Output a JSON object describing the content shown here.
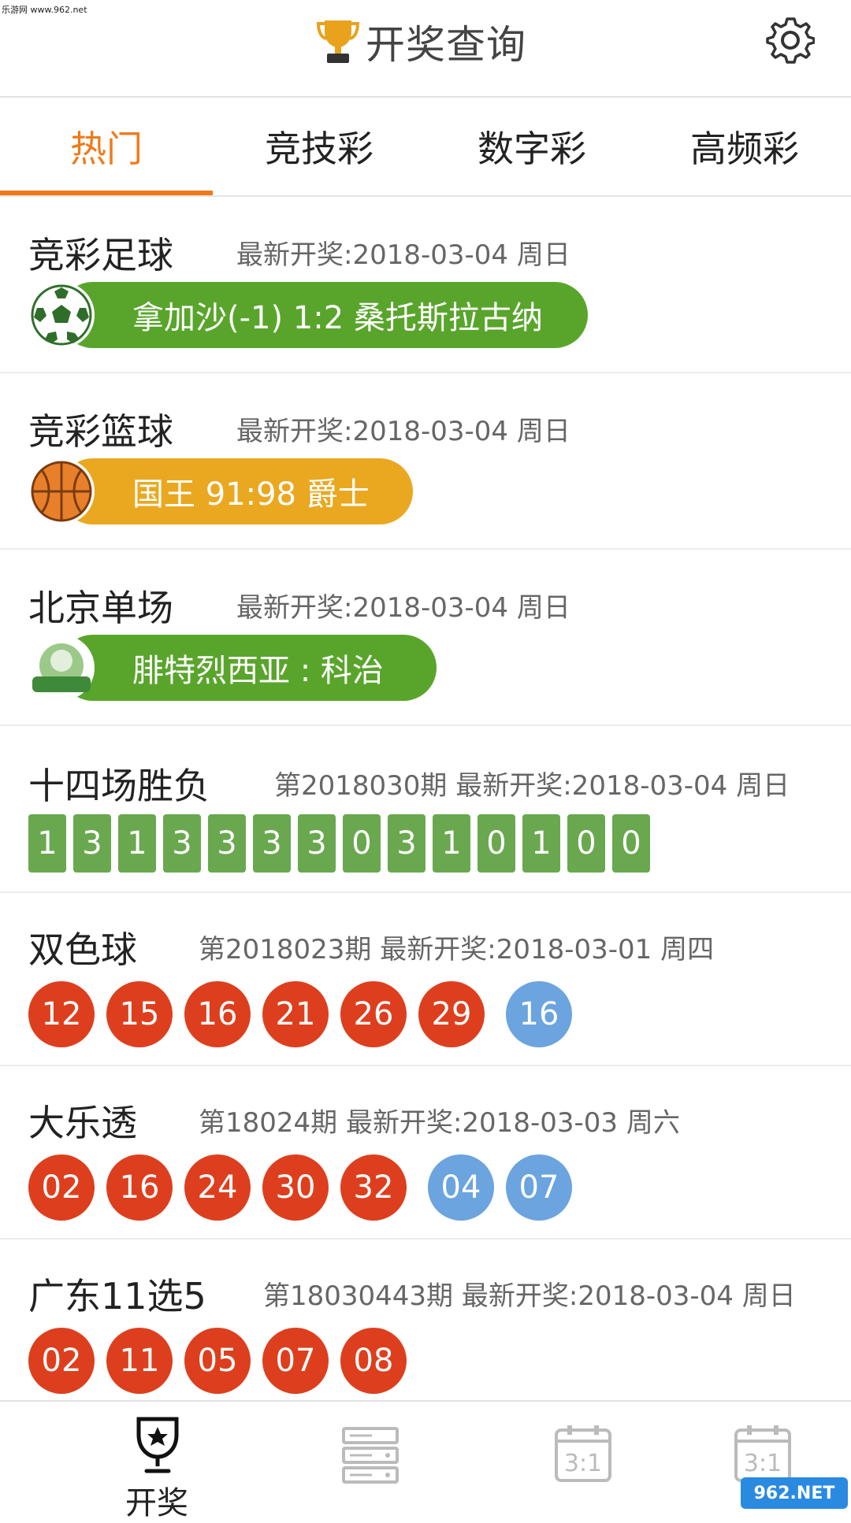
{
  "watermark": "乐游网 www.962.net",
  "header": {
    "title": "开奖查询"
  },
  "tabs": [
    {
      "label": "热门",
      "active": true
    },
    {
      "label": "竞技彩",
      "active": false
    },
    {
      "label": "数字彩",
      "active": false
    },
    {
      "label": "高频彩",
      "active": false
    }
  ],
  "colors": {
    "accent": "#f07a1a",
    "green": "#59a52c",
    "orange": "#eaa820",
    "red_ball": "#dd3f1e",
    "blue_ball": "#6ba4de",
    "square": "#6aa84f"
  },
  "sections": {
    "football": {
      "title": "竞彩足球",
      "meta": "最新开奖:2018-03-04 周日",
      "result": "拿加沙(-1) 1:2 桑托斯拉古纳",
      "icon": "soccer-ball-icon"
    },
    "basketball": {
      "title": "竞彩篮球",
      "meta": "最新开奖:2018-03-04 周日",
      "result": "国王 91:98 爵士",
      "icon": "basketball-icon"
    },
    "beijing": {
      "title": "北京单场",
      "meta": "最新开奖:2018-03-04 周日",
      "result": "腓特烈西亚 : 科治",
      "icon": "danchang-logo-icon"
    },
    "sfc14": {
      "title": "十四场胜负",
      "meta": "第2018030期 最新开奖:2018-03-04 周日",
      "numbers": [
        "1",
        "3",
        "1",
        "3",
        "3",
        "3",
        "3",
        "0",
        "3",
        "1",
        "0",
        "1",
        "0",
        "0"
      ]
    },
    "ssq": {
      "title": "双色球",
      "meta": "第2018023期 最新开奖:2018-03-01 周四",
      "red": [
        "12",
        "15",
        "16",
        "21",
        "26",
        "29"
      ],
      "blue": [
        "16"
      ]
    },
    "dlt": {
      "title": "大乐透",
      "meta": "第18024期 最新开奖:2018-03-03 周六",
      "red": [
        "02",
        "16",
        "24",
        "30",
        "32"
      ],
      "blue": [
        "04",
        "07"
      ]
    },
    "gd115": {
      "title": "广东11选5",
      "meta": "第18030443期 最新开奖:2018-03-04 周日",
      "red": [
        "02",
        "11",
        "05",
        "07",
        "08"
      ],
      "blue": []
    }
  },
  "bottom_nav": [
    {
      "label": "开奖",
      "icon": "trophy-star-icon"
    },
    {
      "label": "",
      "icon": "list-server-icon"
    },
    {
      "label": "",
      "icon": "calendar-score-icon"
    },
    {
      "label": "",
      "icon": "calendar-score-icon"
    }
  ],
  "brand_logo": "962.NET"
}
